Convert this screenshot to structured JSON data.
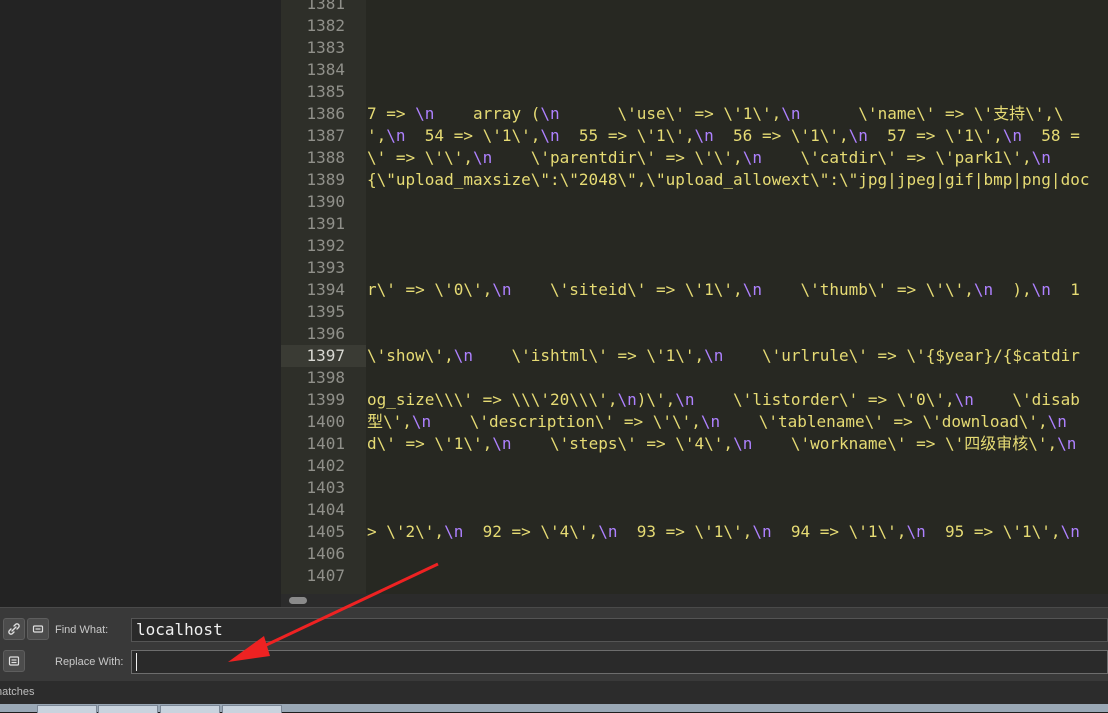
{
  "editor": {
    "current_line": "1397",
    "lines": [
      {
        "n": "1381",
        "code": ""
      },
      {
        "n": "1382",
        "code": ""
      },
      {
        "n": "1383",
        "code": ""
      },
      {
        "n": "1384",
        "code": ""
      },
      {
        "n": "1385",
        "code": ""
      },
      {
        "n": "1386",
        "code": "7 => \\n    array (\\n      \\'use\\' => \\'1\\',\\n      \\'name\\' => \\'支持\\',\\"
      },
      {
        "n": "1387",
        "code": "',\\n  54 => \\'1\\',\\n  55 => \\'1\\',\\n  56 => \\'1\\',\\n  57 => \\'1\\',\\n  58 ="
      },
      {
        "n": "1388",
        "code": "\\' => \\'\\',\\n    \\'parentdir\\' => \\'\\',\\n    \\'catdir\\' => \\'park1\\',\\n"
      },
      {
        "n": "1389",
        "code": "{\\\"upload_maxsize\\\":\\\"2048\\\",\\\"upload_allowext\\\":\\\"jpg|jpeg|gif|bmp|png|doc"
      },
      {
        "n": "1390",
        "code": ""
      },
      {
        "n": "1391",
        "code": ""
      },
      {
        "n": "1392",
        "code": ""
      },
      {
        "n": "1393",
        "code": ""
      },
      {
        "n": "1394",
        "code": "r\\' => \\'0\\',\\n    \\'siteid\\' => \\'1\\',\\n    \\'thumb\\' => \\'\\',\\n  ),\\n  1"
      },
      {
        "n": "1395",
        "code": ""
      },
      {
        "n": "1396",
        "code": ""
      },
      {
        "n": "1397",
        "code": "\\'show\\',\\n    \\'ishtml\\' => \\'1\\',\\n    \\'urlrule\\' => \\'{$year}/{$catdir"
      },
      {
        "n": "1398",
        "code": ""
      },
      {
        "n": "1399",
        "code": "og_size\\\\\\' => \\\\\\'20\\\\\\',\\n)\\',\\n    \\'listorder\\' => \\'0\\',\\n    \\'disab"
      },
      {
        "n": "1400",
        "code": "型\\',\\n    \\'description\\' => \\'\\',\\n    \\'tablename\\' => \\'download\\',\\n"
      },
      {
        "n": "1401",
        "code": "d\\' => \\'1\\',\\n    \\'steps\\' => \\'4\\',\\n    \\'workname\\' => \\'四级审核\\',\\n"
      },
      {
        "n": "1402",
        "code": ""
      },
      {
        "n": "1403",
        "code": ""
      },
      {
        "n": "1404",
        "code": ""
      },
      {
        "n": "1405",
        "code": "> \\'2\\',\\n  92 => \\'4\\',\\n  93 => \\'1\\',\\n  94 => \\'1\\',\\n  95 => \\'1\\',\\n"
      },
      {
        "n": "1406",
        "code": ""
      },
      {
        "n": "1407",
        "code": ""
      }
    ]
  },
  "find_panel": {
    "regex_icon": "link-icon",
    "case_icon": "minus-icon",
    "find_label": "Find What:",
    "find_value": "localhost",
    "replace_label": "Replace With:",
    "replace_value": "",
    "wrap_icon": "equals-icon"
  },
  "status": {
    "text": "natches"
  },
  "annotation": {
    "color": "#ee2222"
  }
}
